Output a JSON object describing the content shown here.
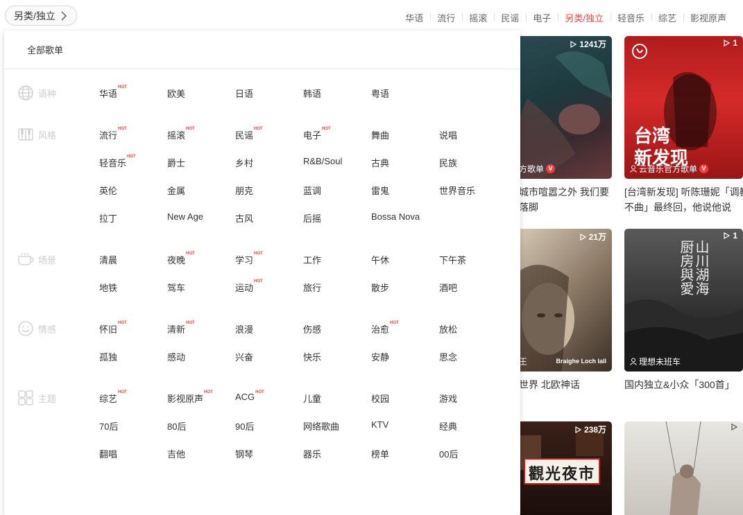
{
  "category_button": {
    "label": "另类/独立"
  },
  "hot_tags": [
    "华语",
    "流行",
    "摇滚",
    "民谣",
    "电子",
    "另类/独立",
    "轻音乐",
    "综艺",
    "影视原声"
  ],
  "active_hot_tag": "另类/独立",
  "panel": {
    "all_label": "全部歌单",
    "groups": [
      {
        "name": "语种",
        "icon": "globe-icon",
        "rows": [
          [
            {
              "t": "华语",
              "hot": true
            },
            {
              "t": "欧美"
            },
            {
              "t": "日语"
            },
            {
              "t": "韩语"
            },
            {
              "t": "粤语"
            }
          ]
        ]
      },
      {
        "name": "风格",
        "icon": "piano-icon",
        "rows": [
          [
            {
              "t": "流行",
              "hot": true
            },
            {
              "t": "摇滚",
              "hot": true
            },
            {
              "t": "民谣",
              "hot": true
            },
            {
              "t": "电子",
              "hot": true
            },
            {
              "t": "舞曲"
            },
            {
              "t": "说唱"
            }
          ],
          [
            {
              "t": "轻音乐",
              "hot": true
            },
            {
              "t": "爵士"
            },
            {
              "t": "乡村"
            },
            {
              "t": "R&B/Soul"
            },
            {
              "t": "古典"
            },
            {
              "t": "民族"
            }
          ],
          [
            {
              "t": "英伦"
            },
            {
              "t": "金属"
            },
            {
              "t": "朋克"
            },
            {
              "t": "蓝调"
            },
            {
              "t": "雷鬼"
            },
            {
              "t": "世界音乐"
            }
          ],
          [
            {
              "t": "拉丁"
            },
            {
              "t": "New Age"
            },
            {
              "t": "古风"
            },
            {
              "t": "后摇"
            },
            {
              "t": "Bossa Nova"
            }
          ]
        ]
      },
      {
        "name": "场景",
        "icon": "coffee-icon",
        "rows": [
          [
            {
              "t": "清晨"
            },
            {
              "t": "夜晚",
              "hot": true
            },
            {
              "t": "学习",
              "hot": true
            },
            {
              "t": "工作"
            },
            {
              "t": "午休"
            },
            {
              "t": "下午茶"
            }
          ],
          [
            {
              "t": "地铁"
            },
            {
              "t": "驾车"
            },
            {
              "t": "运动",
              "hot": true
            },
            {
              "t": "旅行"
            },
            {
              "t": "散步"
            },
            {
              "t": "酒吧"
            }
          ]
        ]
      },
      {
        "name": "情感",
        "icon": "smile-icon",
        "rows": [
          [
            {
              "t": "怀旧",
              "hot": true
            },
            {
              "t": "清新",
              "hot": true
            },
            {
              "t": "浪漫"
            },
            {
              "t": "伤感"
            },
            {
              "t": "治愈",
              "hot": true
            },
            {
              "t": "放松"
            }
          ],
          [
            {
              "t": "孤独"
            },
            {
              "t": "感动"
            },
            {
              "t": "兴奋"
            },
            {
              "t": "快乐"
            },
            {
              "t": "安静"
            },
            {
              "t": "思念"
            }
          ]
        ]
      },
      {
        "name": "主题",
        "icon": "grid-icon",
        "rows": [
          [
            {
              "t": "综艺",
              "hot": true
            },
            {
              "t": "影视原声",
              "hot": true
            },
            {
              "t": "ACG",
              "hot": true
            },
            {
              "t": "儿童"
            },
            {
              "t": "校园"
            },
            {
              "t": "游戏"
            }
          ],
          [
            {
              "t": "70后"
            },
            {
              "t": "80后"
            },
            {
              "t": "90后"
            },
            {
              "t": "网络歌曲"
            },
            {
              "t": "KTV"
            },
            {
              "t": "经典"
            }
          ],
          [
            {
              "t": "翻唱"
            },
            {
              "t": "吉他"
            },
            {
              "t": "钢琴"
            },
            {
              "t": "器乐"
            },
            {
              "t": "榜单"
            },
            {
              "t": "00后"
            }
          ]
        ]
      }
    ],
    "hot_label": "HOT"
  },
  "cards": [
    {
      "count": "1241万",
      "creator": "方歌单",
      "title_lines": [
        "城市喧嚣之外 我们要",
        "落脚"
      ],
      "verified": true
    },
    {
      "count": "1",
      "creator": "云音乐官方歌单",
      "overlay_text": [
        "台湾",
        "新发现"
      ],
      "title_lines": [
        "[台湾新发现] 听陈珊妮「调教",
        "不曲」最终回，他说他说"
      ],
      "verified": true
    },
    {
      "count": "21万",
      "creator": "王",
      "watermark": "Braighe Loch Iall",
      "title_lines": [
        "世界 北欧神话"
      ]
    },
    {
      "count": "1",
      "creator": "理想未班车",
      "overlay_text": [
        "山川湖海",
        "厨房與愛"
      ],
      "title_lines": [
        "国内独立&小众「300首」"
      ]
    },
    {
      "count": "238万",
      "overlay_text": [
        "觀光夜市"
      ]
    },
    {
      "count": ""
    }
  ],
  "colors": {
    "accent": "#ec4141",
    "muted": "#cccccc"
  }
}
